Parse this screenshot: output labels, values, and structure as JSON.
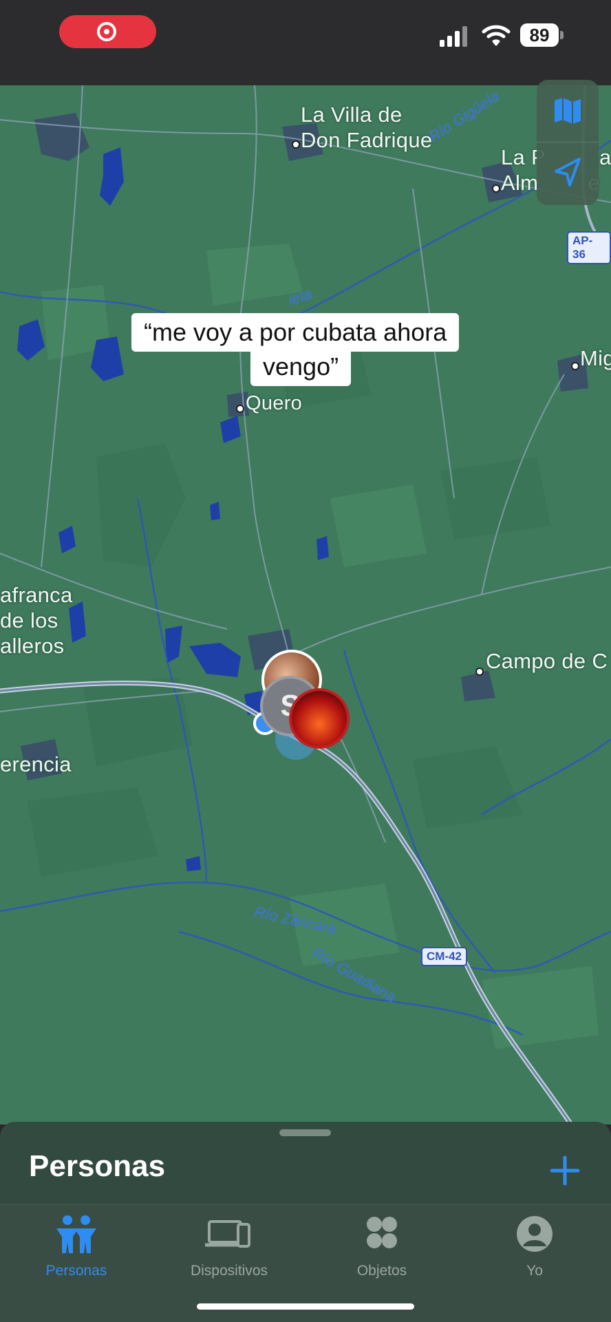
{
  "status_bar": {
    "battery": "89",
    "recording": true,
    "colors": {
      "recording": "#e5343f"
    }
  },
  "map": {
    "places": [
      {
        "key": "villa",
        "label_line1": "La Villa de",
        "label_line2": "Don Fadrique"
      },
      {
        "key": "la_puebla",
        "label_line1": "La P",
        "label_line1b": "a",
        "label_line2": "Alm",
        "label_line2b": "e"
      },
      {
        "key": "quero",
        "label": "Quero"
      },
      {
        "key": "mig",
        "label": "Mig"
      },
      {
        "key": "villafranca",
        "label_line1": "afranca",
        "label_line2": "de los",
        "label_line3": "alleros"
      },
      {
        "key": "campo",
        "label": "Campo de C"
      },
      {
        "key": "herencia",
        "label": "erencia"
      }
    ],
    "rivers": [
      {
        "key": "giguela_ne",
        "label": "Río Gigüela"
      },
      {
        "key": "giguela_mid",
        "label": "iela"
      },
      {
        "key": "zancara",
        "label": "Río Záncara"
      },
      {
        "key": "guadiana",
        "label": "Río Guadiana"
      }
    ],
    "roads": [
      {
        "key": "ap36",
        "label": "AP-36"
      },
      {
        "key": "cm42",
        "label": "CM-42"
      }
    ],
    "avatar_initial": "S",
    "controls": {
      "map_mode_icon": "map-icon",
      "locate_icon": "location-arrow-icon"
    },
    "colors": {
      "land": "#3f7a5d",
      "water": "#1f3fa8",
      "town": "#3a4f66"
    }
  },
  "overlay_caption": {
    "line1": "“me voy a por cubata ahora",
    "line2": "vengo”"
  },
  "sheet": {
    "title": "Personas",
    "add_icon": "plus-icon"
  },
  "tabbar": {
    "tabs": [
      {
        "label": "Personas",
        "icon": "people-icon",
        "active": true
      },
      {
        "label": "Dispositivos",
        "icon": "devices-icon",
        "active": false
      },
      {
        "label": "Objetos",
        "icon": "items-icon",
        "active": false
      },
      {
        "label": "Yo",
        "icon": "me-icon",
        "active": false
      }
    ],
    "colors": {
      "active": "#2f8cf0",
      "inactive": "#9aa6a0"
    }
  }
}
